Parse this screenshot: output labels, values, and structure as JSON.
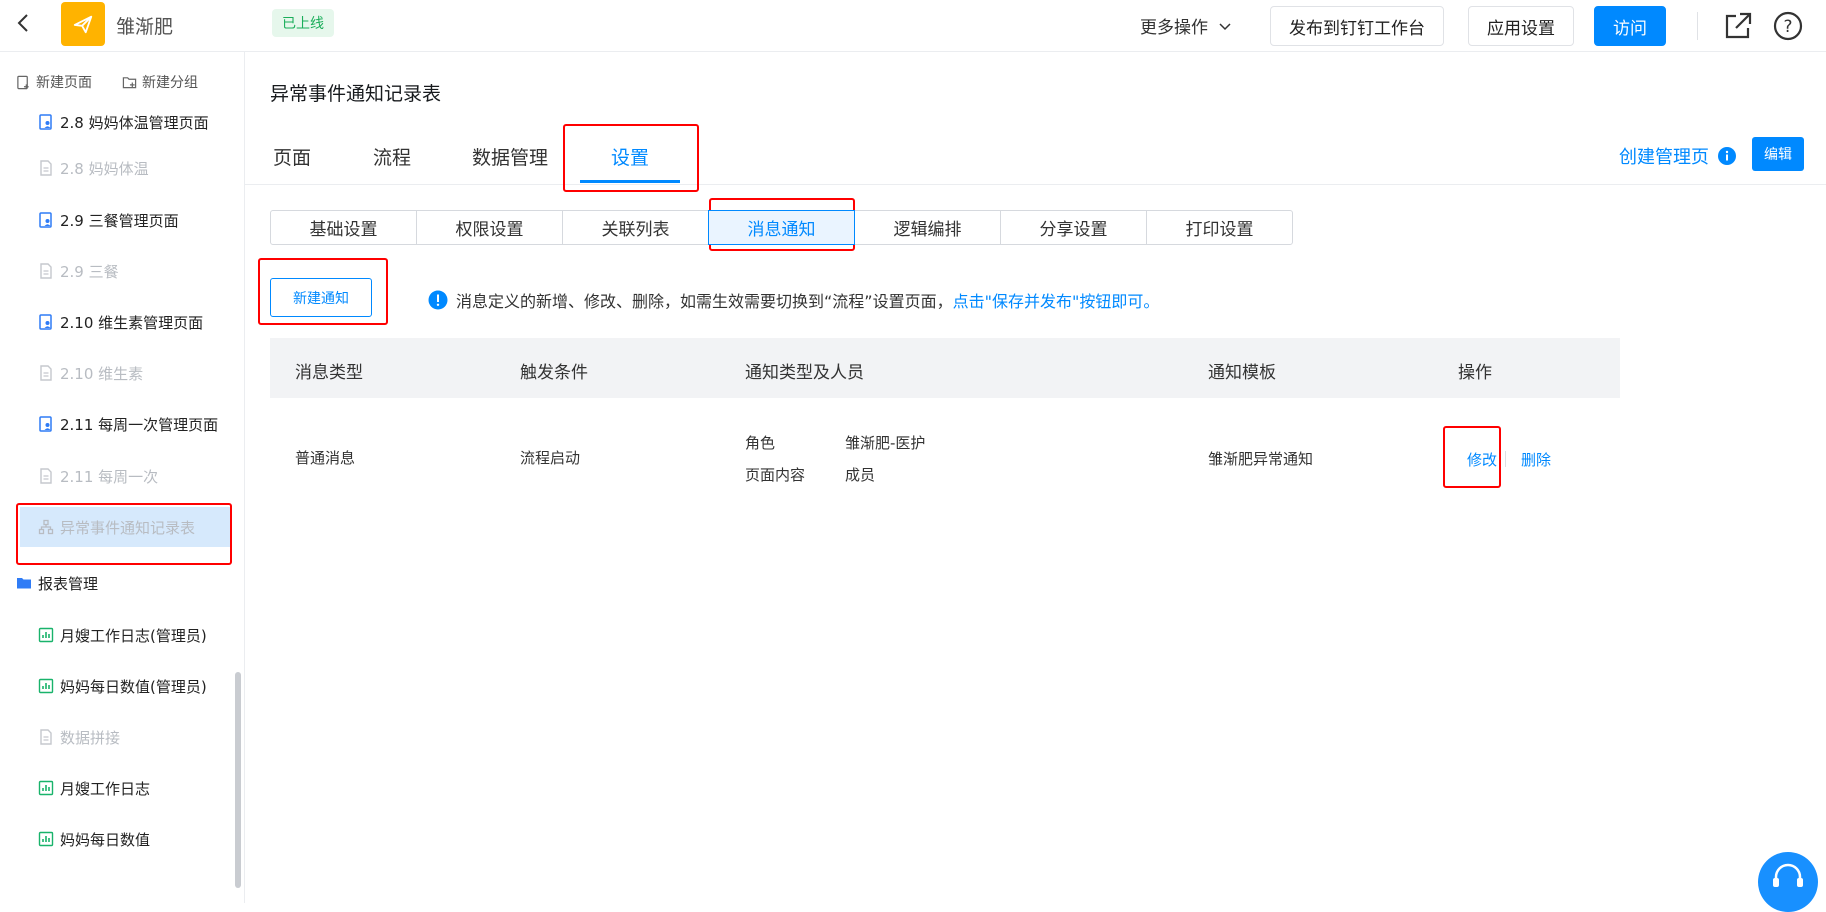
{
  "topbar": {
    "app_name": "雏渐肥",
    "status": "已上线",
    "more_ops": "更多操作",
    "publish": "发布到钉钉工作台",
    "app_settings": "应用设置",
    "visit": "访问"
  },
  "sidebar": {
    "new_page": "新建页面",
    "new_group": "新建分组",
    "items": [
      {
        "label": "2.8 妈妈体温管理页面"
      },
      {
        "label": "2.8 妈妈体温"
      },
      {
        "label": "2.9 三餐管理页面"
      },
      {
        "label": "2.9 三餐"
      },
      {
        "label": "2.10 维生素管理页面"
      },
      {
        "label": "2.10 维生素"
      },
      {
        "label": "2.11 每周一次管理页面"
      },
      {
        "label": "2.11 每周一次"
      },
      {
        "label": "异常事件通知记录表"
      },
      {
        "label": "报表管理"
      },
      {
        "label": "月嫂工作日志(管理员)"
      },
      {
        "label": "妈妈每日数值(管理员)"
      },
      {
        "label": "数据拼接"
      },
      {
        "label": "月嫂工作日志"
      },
      {
        "label": "妈妈每日数值"
      }
    ]
  },
  "main": {
    "title": "异常事件通知记录表",
    "tabs": [
      "页面",
      "流程",
      "数据管理",
      "设置"
    ],
    "create_admin": "创建管理页",
    "edit": "编辑",
    "subtabs": [
      "基础设置",
      "权限设置",
      "关联列表",
      "消息通知",
      "逻辑编排",
      "分享设置",
      "打印设置"
    ],
    "new_notify": "新建通知",
    "notice_text": "消息定义的新增、修改、删除，如需生效需要切换到“流程”设置页面，",
    "notice_link": "点击\"保存并发布\"按钮即可。",
    "table": {
      "headers": [
        "消息类型",
        "触发条件",
        "通知类型及人员",
        "通知模板",
        "操作"
      ],
      "row": {
        "type": "普通消息",
        "trigger": "流程启动",
        "role_label": "角色",
        "role_value": "雏渐肥-医护",
        "content_label": "页面内容",
        "content_value": "成员",
        "template": "雏渐肥异常通知",
        "modify": "修改",
        "delete": "删除"
      }
    }
  },
  "colors": {
    "accent": "#0089ff",
    "highlight": "#ff0000",
    "logo": "#ffb300",
    "status_green": "#1aae5a"
  }
}
